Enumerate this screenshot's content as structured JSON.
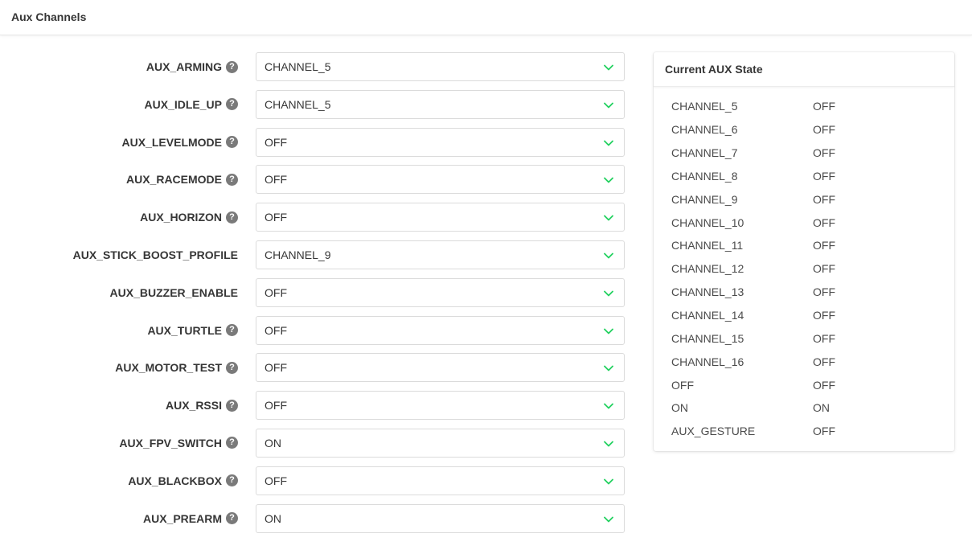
{
  "header": {
    "title": "Aux Channels"
  },
  "aux_settings": [
    {
      "label": "AUX_ARMING",
      "has_help": true,
      "value": "CHANNEL_5"
    },
    {
      "label": "AUX_IDLE_UP",
      "has_help": true,
      "value": "CHANNEL_5"
    },
    {
      "label": "AUX_LEVELMODE",
      "has_help": true,
      "value": "OFF"
    },
    {
      "label": "AUX_RACEMODE",
      "has_help": true,
      "value": "OFF"
    },
    {
      "label": "AUX_HORIZON",
      "has_help": true,
      "value": "OFF"
    },
    {
      "label": "AUX_STICK_BOOST_PROFILE",
      "has_help": false,
      "value": "CHANNEL_9"
    },
    {
      "label": "AUX_BUZZER_ENABLE",
      "has_help": false,
      "value": "OFF"
    },
    {
      "label": "AUX_TURTLE",
      "has_help": true,
      "value": "OFF"
    },
    {
      "label": "AUX_MOTOR_TEST",
      "has_help": true,
      "value": "OFF"
    },
    {
      "label": "AUX_RSSI",
      "has_help": true,
      "value": "OFF"
    },
    {
      "label": "AUX_FPV_SWITCH",
      "has_help": true,
      "value": "ON"
    },
    {
      "label": "AUX_BLACKBOX",
      "has_help": true,
      "value": "OFF"
    },
    {
      "label": "AUX_PREARM",
      "has_help": true,
      "value": "ON"
    }
  ],
  "help_glyph": "?",
  "state_card": {
    "title": "Current AUX State",
    "rows": [
      {
        "channel": "CHANNEL_5",
        "state": "OFF"
      },
      {
        "channel": "CHANNEL_6",
        "state": "OFF"
      },
      {
        "channel": "CHANNEL_7",
        "state": "OFF"
      },
      {
        "channel": "CHANNEL_8",
        "state": "OFF"
      },
      {
        "channel": "CHANNEL_9",
        "state": "OFF"
      },
      {
        "channel": "CHANNEL_10",
        "state": "OFF"
      },
      {
        "channel": "CHANNEL_11",
        "state": "OFF"
      },
      {
        "channel": "CHANNEL_12",
        "state": "OFF"
      },
      {
        "channel": "CHANNEL_13",
        "state": "OFF"
      },
      {
        "channel": "CHANNEL_14",
        "state": "OFF"
      },
      {
        "channel": "CHANNEL_15",
        "state": "OFF"
      },
      {
        "channel": "CHANNEL_16",
        "state": "OFF"
      },
      {
        "channel": "OFF",
        "state": "OFF"
      },
      {
        "channel": "ON",
        "state": "ON"
      },
      {
        "channel": "AUX_GESTURE",
        "state": "OFF"
      }
    ]
  },
  "colors": {
    "chevron": "#23d160",
    "help_icon": "#7a7a7a",
    "text": "#363636"
  },
  "icons": {
    "help": "question-circle-icon",
    "dropdown": "chevron-down-icon"
  }
}
